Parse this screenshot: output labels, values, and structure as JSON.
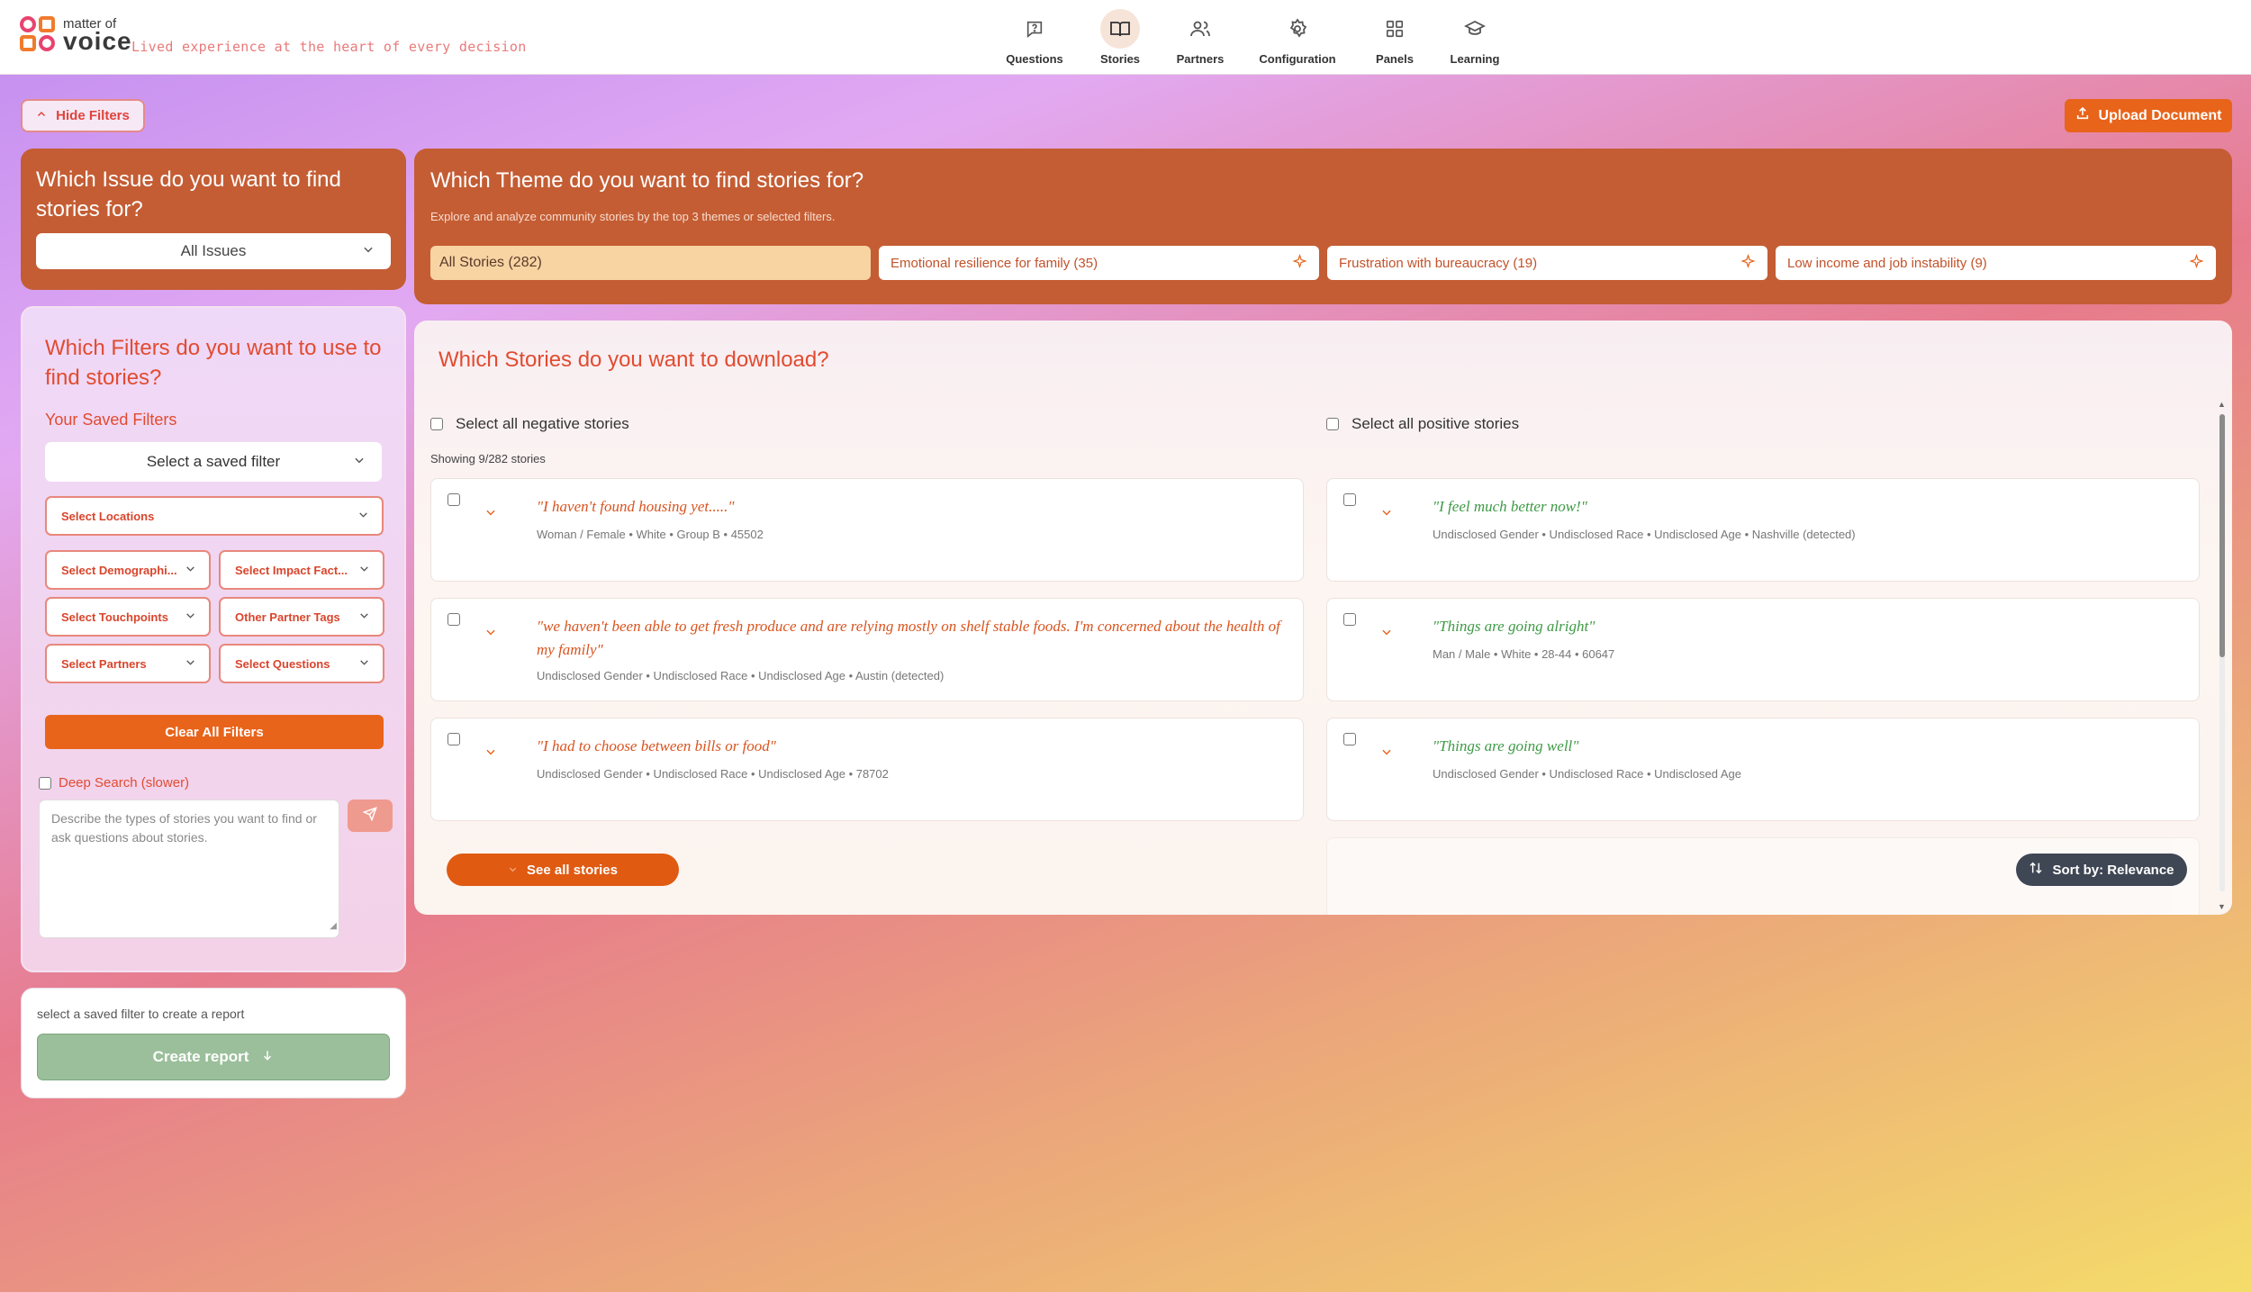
{
  "brand": {
    "logo_top": "matter of",
    "logo_bottom": "voice",
    "tagline": "Lived experience at the heart of every decision"
  },
  "nav": {
    "items": [
      {
        "label": "Questions",
        "icon": "question-icon"
      },
      {
        "label": "Stories",
        "icon": "book-icon",
        "active": true
      },
      {
        "label": "Partners",
        "icon": "users-icon"
      },
      {
        "label": "Configuration",
        "icon": "gear-icon"
      },
      {
        "label": "Panels",
        "icon": "grid-icon"
      },
      {
        "label": "Learning",
        "icon": "graduation-cap-icon"
      }
    ]
  },
  "toolbar": {
    "hide_filters": "Hide Filters",
    "upload_document": "Upload Document"
  },
  "issue": {
    "title": "Which Issue do you want to find stories for?",
    "selected": "All Issues"
  },
  "filters": {
    "title": "Which Filters do you want to use to find stories?",
    "saved_label": "Your Saved Filters",
    "saved_select": "Select a saved filter",
    "locations": "Select Locations",
    "demographics": "Select Demographi...",
    "impact": "Select Impact Fact...",
    "touchpoints": "Select Touchpoints",
    "partner_tags": "Other Partner Tags",
    "partners": "Select Partners",
    "questions": "Select Questions",
    "clear_all": "Clear All Filters",
    "deep_search": "Deep Search (slower)",
    "ask_placeholder": "Describe the types of stories you want to find or ask questions about stories."
  },
  "report": {
    "hint": "select a saved filter to create a report",
    "create": "Create report"
  },
  "theme": {
    "title": "Which Theme do you want to find stories for?",
    "subtitle": "Explore and analyze community stories by the top 3 themes or selected filters.",
    "chips": [
      {
        "label": "All Stories (282)",
        "active": true
      },
      {
        "label": "Emotional resilience for family (35)"
      },
      {
        "label": "Frustration with bureaucracy (19)"
      },
      {
        "label": "Low income and job instability (9)"
      }
    ]
  },
  "stories": {
    "title": "Which Stories do you want to download?",
    "select_negative": "Select all negative stories",
    "select_positive": "Select all positive stories",
    "showing": "Showing 9/282 stories",
    "negative": [
      {
        "quote": "\"I haven't found housing yet.....\"",
        "meta": "Woman / Female • White • Group B • 45502"
      },
      {
        "quote": "\"we haven't been able to get fresh produce and are relying mostly on shelf stable foods. I'm concerned about the health of my family\"",
        "meta": "Undisclosed Gender • Undisclosed Race • Undisclosed Age • Austin (detected)"
      },
      {
        "quote": "\"I had to choose between bills or food\"",
        "meta": "Undisclosed Gender • Undisclosed Race • Undisclosed Age • 78702"
      }
    ],
    "positive": [
      {
        "quote": "\"I feel much better now!\"",
        "meta": "Undisclosed Gender • Undisclosed Race • Undisclosed Age • Nashville (detected)"
      },
      {
        "quote": "\"Things are going alright\"",
        "meta": "Man / Male • White • 28-44 • 60647"
      },
      {
        "quote": "\"Things are going well\"",
        "meta": "Undisclosed Gender • Undisclosed Race • Undisclosed Age"
      }
    ],
    "see_all": "See all stories",
    "sort": "Sort by: Relevance"
  },
  "colors": {
    "accent": "#e8641b",
    "panel": "#c45d34",
    "negative_text": "#d9541f",
    "positive_text": "#3e9a46"
  }
}
